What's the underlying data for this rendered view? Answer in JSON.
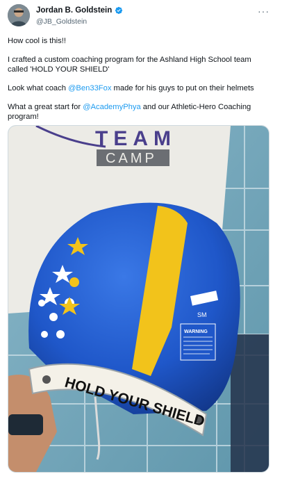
{
  "author": {
    "display_name": "Jordan B. Goldstein",
    "handle": "@JB_Goldstein",
    "verified": true,
    "avatar_icon": "user-avatar-icon"
  },
  "menu": {
    "more_label": "···"
  },
  "tweet": {
    "line1": "How cool is this!!",
    "line2": "I crafted a custom coaching program for the Ashland High School team called 'HOLD YOUR SHIELD'",
    "line3_before": "Look what coach ",
    "line3_mention": "@Ben33Fox",
    "line3_after": " made for his guys to put on their helmets",
    "line4_before": "What a great start for ",
    "line4_mention": "@AcademyPhya",
    "line4_after": " and our Athletic-Hero Coaching program!"
  },
  "media": {
    "banner_text_1": "TEAM",
    "banner_text_2": "CAMP",
    "helmet_shield_text": "HOLD YOUR SHIELD",
    "helmet_size": "SM",
    "helmet_warning": "WARNING",
    "colors": {
      "helmet_blue": "#1f57c9",
      "stripe_yellow": "#f2c31b",
      "banner_purple": "#4a3f8c"
    }
  }
}
